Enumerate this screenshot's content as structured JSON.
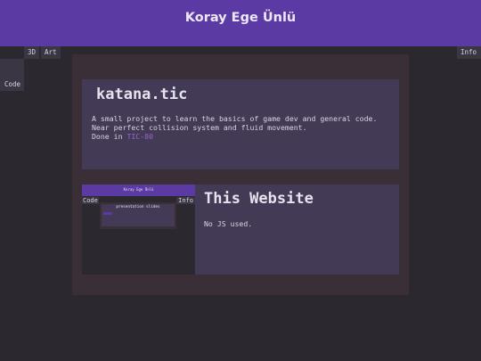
{
  "header": {
    "title": "Koray Ege Ünlü"
  },
  "nav": {
    "items": [
      {
        "label": "3D"
      },
      {
        "label": "Art"
      },
      {
        "label": "Info"
      },
      {
        "label": "Code"
      }
    ]
  },
  "projects": [
    {
      "title": "katana.tic",
      "description": [
        "A small project to learn the basics of game dev and general code.",
        "Near perfect collision system and fluid movement."
      ],
      "done_prefix": "Done in ",
      "done_link": "TIC-80"
    },
    {
      "title": "This Website",
      "description": "No JS used.",
      "thumbnail": {
        "title": "Koray Ege Ünlü",
        "code_label": "Code",
        "info_label": "Info",
        "inner_text": "presentation slides"
      }
    }
  ],
  "colors": {
    "header": "#5b3aa3",
    "background": "#2b2830",
    "card": "#433b55",
    "panel": "#3a2f37",
    "link": "#9a63c8"
  }
}
